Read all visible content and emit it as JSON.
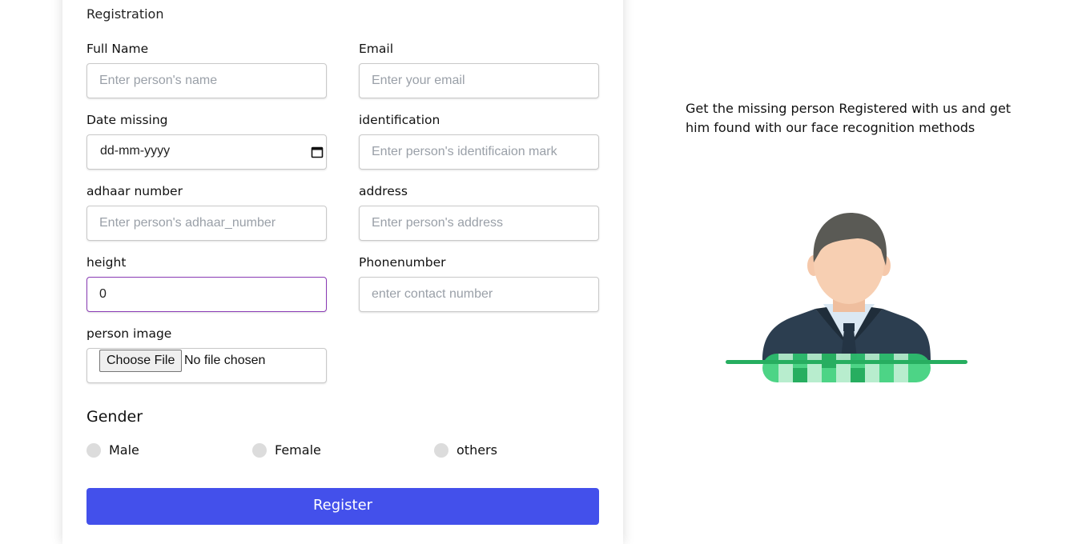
{
  "form": {
    "title": "Registration",
    "fields": {
      "full_name": {
        "label": "Full Name",
        "placeholder": "Enter person's name"
      },
      "email": {
        "label": "Email",
        "placeholder": "Enter your email"
      },
      "date_missing": {
        "label": "Date missing",
        "value": "dd-mm-yyyy"
      },
      "identification": {
        "label": "identification",
        "placeholder": "Enter person's identificaion mark"
      },
      "adhaar_number": {
        "label": "adhaar number",
        "placeholder": "Enter person's adhaar_number"
      },
      "address": {
        "label": "address",
        "placeholder": "Enter person's address"
      },
      "height": {
        "label": "height",
        "value": "0"
      },
      "phone_number": {
        "label": "Phonenumber",
        "placeholder": "enter contact number"
      },
      "person_image": {
        "label": "person image",
        "button": "Choose File",
        "status": "No file chosen"
      }
    },
    "gender": {
      "title": "Gender",
      "options": [
        "Male",
        "Female",
        "others"
      ]
    },
    "register_label": "Register"
  },
  "aside": {
    "tagline": "Get the missing person Registered with us and get him found with our face recognition methods",
    "illustration_icon": "person-face-scan-icon"
  },
  "colors": {
    "primary_button": "#4350eb",
    "focus_border": "#8a3bb5",
    "scan_green": "#27ae60"
  }
}
